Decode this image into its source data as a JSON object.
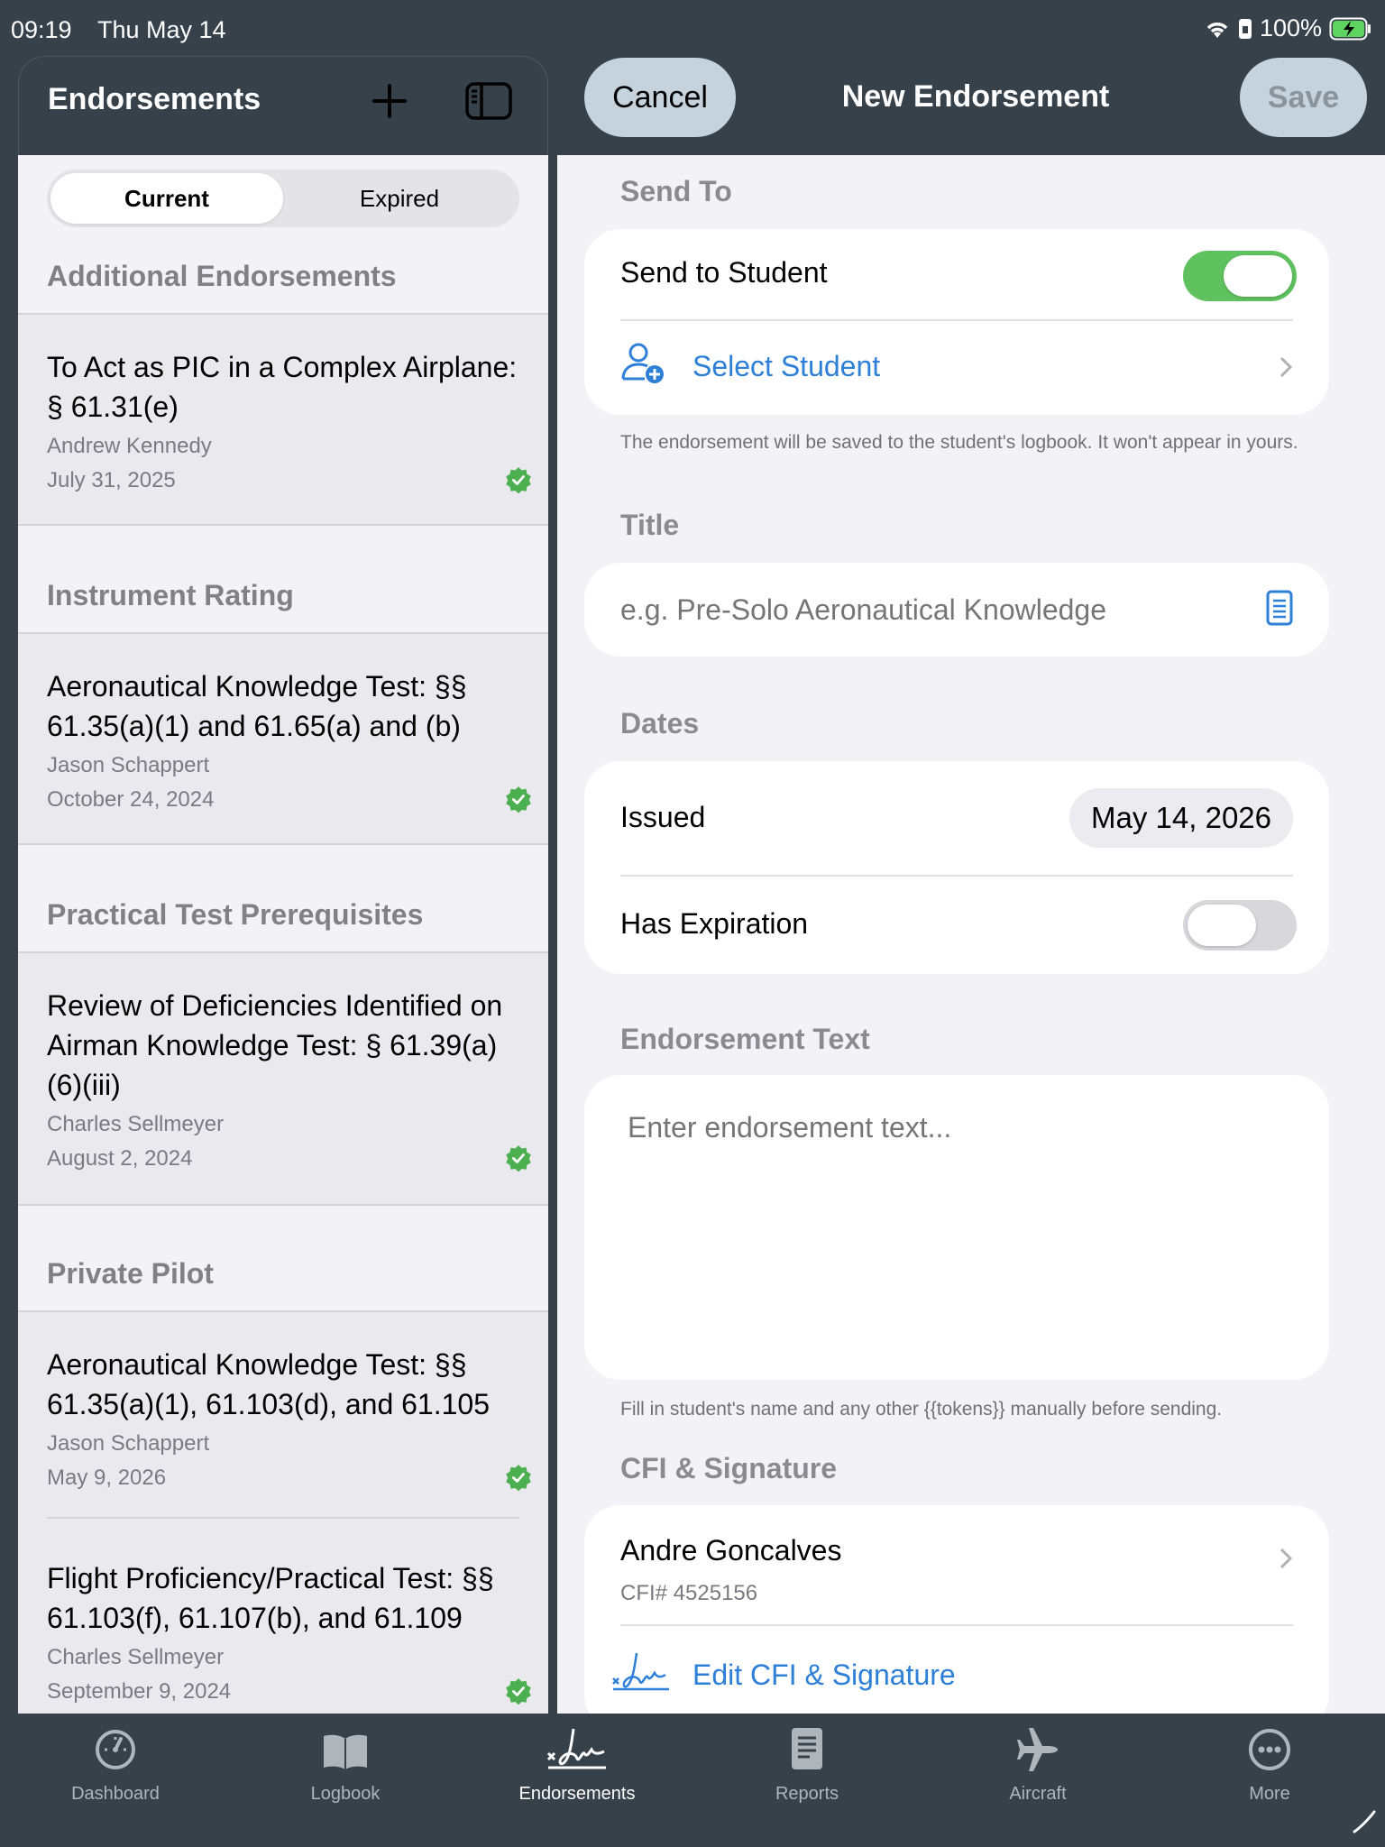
{
  "status_bar": {
    "time": "09:19",
    "date": "Thu May 14",
    "battery": "100%"
  },
  "left_header": {
    "title": "Endorsements"
  },
  "right_header": {
    "cancel_label": "Cancel",
    "title": "New Endorsement",
    "save_label": "Save"
  },
  "segments": {
    "current": "Current",
    "expired": "Expired"
  },
  "sections": [
    {
      "title": "Additional Endorsements",
      "items": [
        {
          "title": "To Act as PIC in a Complex Airplane: § 61.31(e)",
          "name": "Andrew Kennedy",
          "date": "July 31, 2025"
        }
      ]
    },
    {
      "title": "Instrument Rating",
      "items": [
        {
          "title": "Aeronautical Knowledge Test: §§ 61.35(a)(1) and 61.65(a) and (b)",
          "name": "Jason Schappert",
          "date": "October 24, 2024"
        }
      ]
    },
    {
      "title": "Practical Test Prerequisites",
      "items": [
        {
          "title": "Review of Deficiencies Identified on Airman Knowledge Test: § 61.39(a)(6)(iii)",
          "name": "Charles Sellmeyer",
          "date": "August 2, 2024"
        }
      ]
    },
    {
      "title": "Private Pilot",
      "items": [
        {
          "title": "Aeronautical Knowledge Test: §§ 61.35(a)(1), 61.103(d), and 61.105",
          "name": "Jason Schappert",
          "date": "May 9, 2026"
        },
        {
          "title": "Flight Proficiency/Practical Test: §§ 61.103(f), 61.107(b), and 61.109",
          "name": "Charles Sellmeyer",
          "date": "September 9, 2024"
        }
      ]
    }
  ],
  "form": {
    "send_to": {
      "label": "Send To",
      "send_to_student": "Send to Student",
      "send_to_student_on": true,
      "select_student": "Select Student",
      "note": "The endorsement will be saved to the student's logbook. It won't appear in yours."
    },
    "title": {
      "label": "Title",
      "placeholder": "e.g. Pre-Solo Aeronautical Knowledge"
    },
    "dates": {
      "label": "Dates",
      "issued_label": "Issued",
      "issued_value": "May 14, 2026",
      "has_expiration": "Has Expiration",
      "has_expiration_on": false
    },
    "text": {
      "label": "Endorsement Text",
      "placeholder": "Enter endorsement text...",
      "note": "Fill in student's name and any other {{tokens}} manually before sending."
    },
    "cfi": {
      "label": "CFI & Signature",
      "name": "Andre Goncalves",
      "number": "CFI# 4525156",
      "edit_label": "Edit CFI & Signature"
    }
  },
  "tabs": [
    {
      "label": "Dashboard",
      "icon": "gauge-icon",
      "active": false
    },
    {
      "label": "Logbook",
      "icon": "book-icon",
      "active": false
    },
    {
      "label": "Endorsements",
      "icon": "signature-icon",
      "active": true
    },
    {
      "label": "Reports",
      "icon": "document-icon",
      "active": false
    },
    {
      "label": "Aircraft",
      "icon": "airplane-icon",
      "active": false
    },
    {
      "label": "More",
      "icon": "ellipsis-icon",
      "active": false
    }
  ],
  "colors": {
    "accent": "#2d7fd7",
    "toggle_on": "#5fc25f",
    "header_bg": "#36414a",
    "verified": "#4caf50"
  }
}
